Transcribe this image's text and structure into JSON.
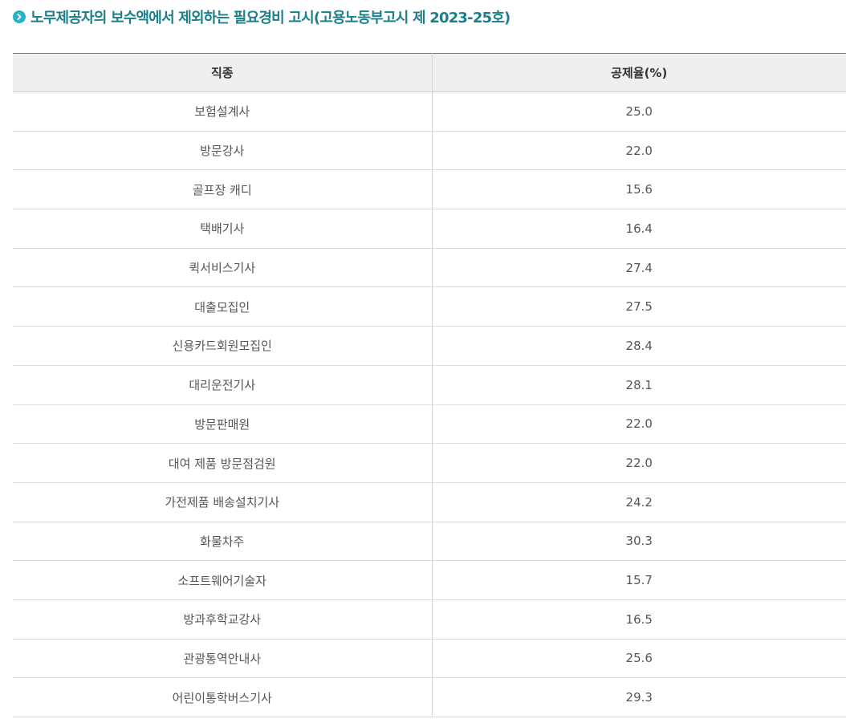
{
  "heading": {
    "icon": "chevron-right-circle-icon",
    "accent_color": "#28b4c4",
    "text_color": "#1b7f8a",
    "title": "노무제공자의 보수액에서 제외하는 필요경비 고시(고용노동부고시 제 2023-25호)"
  },
  "table": {
    "headers": [
      "직종",
      "공제율(%)"
    ],
    "rows": [
      [
        "보험설계사",
        "25.0"
      ],
      [
        "방문강사",
        "22.0"
      ],
      [
        "골프장 캐디",
        "15.6"
      ],
      [
        "택배기사",
        "16.4"
      ],
      [
        "퀵서비스기사",
        "27.4"
      ],
      [
        "대출모집인",
        "27.5"
      ],
      [
        "신용카드회원모집인",
        "28.4"
      ],
      [
        "대리운전기사",
        "28.1"
      ],
      [
        "방문판매원",
        "22.0"
      ],
      [
        "대여 제품 방문점검원",
        "22.0"
      ],
      [
        "가전제품 배송설치기사",
        "24.2"
      ],
      [
        "화물차주",
        "30.3"
      ],
      [
        "소프트웨어기술자",
        "15.7"
      ],
      [
        "방과후학교강사",
        "16.5"
      ],
      [
        "관광통역안내사",
        "25.6"
      ],
      [
        "어린이통학버스기사",
        "29.3"
      ]
    ]
  }
}
